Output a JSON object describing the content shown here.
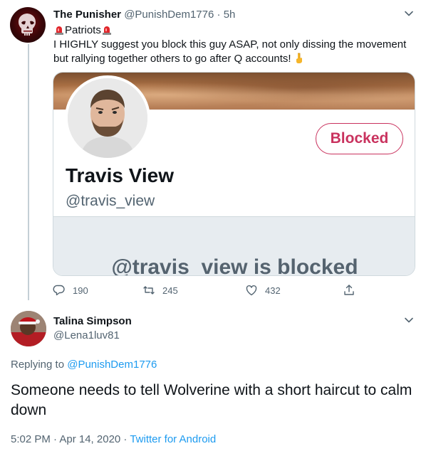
{
  "tweet1": {
    "author_name": "The Punisher",
    "author_handle": "@PunishDem1776",
    "separator": " · ",
    "time": "5h",
    "label": "Patriots",
    "body": "I HIGHLY suggest you block this guy ASAP, not only dissing the movement but rallying together others to go after Q accounts!",
    "card": {
      "profile_name": "Travis View",
      "profile_handle": "@travis_view",
      "status_button": "Blocked",
      "blocked_notice": "@travis_view is blocked"
    },
    "actions": {
      "replies": "190",
      "retweets": "245",
      "likes": "432"
    }
  },
  "tweet2": {
    "author_name": "Talina Simpson",
    "author_handle": "@Lena1luv81",
    "replying_prefix": "Replying to ",
    "replying_to": "@PunishDem1776",
    "body": "Someone needs to tell Wolverine with a short haircut to calm down",
    "timestamp": "5:02 PM · Apr 14, 2020 · ",
    "source": "Twitter for Android"
  },
  "colors": {
    "blocked": "#c9325e",
    "link": "#1d9bf0",
    "muted": "#536471"
  },
  "icons": [
    "punisher-skull-avatar",
    "siren-emoji",
    "pointing-down-emoji",
    "chevron-down-icon",
    "reply-icon",
    "retweet-icon",
    "like-icon",
    "share-icon"
  ]
}
